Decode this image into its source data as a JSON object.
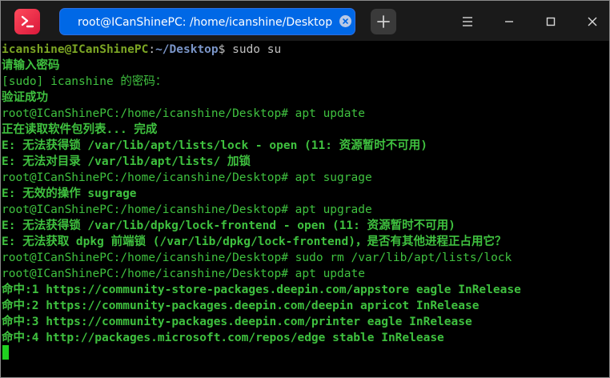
{
  "window": {
    "tab_title": "root@ICanShinePC: /home/icanshine/Desktop"
  },
  "terminal": {
    "first_prompt": {
      "user": "icanshine@ICanShinePC",
      "sep": ":",
      "path": "~/Desktop",
      "symbol": "$",
      "command": " sudo su"
    },
    "lines": [
      "请输入密码",
      "[sudo] icanshine 的密码：",
      "验证成功",
      "root@ICanShinePC:/home/icanshine/Desktop# apt update",
      "正在读取软件包列表... 完成",
      "E: 无法获得锁 /var/lib/apt/lists/lock - open (11: 资源暂时不可用)",
      "E: 无法对目录 /var/lib/apt/lists/ 加锁",
      "root@ICanShinePC:/home/icanshine/Desktop# apt sugrage",
      "E: 无效的操作 sugrage",
      "root@ICanShinePC:/home/icanshine/Desktop# apt upgrade",
      "E: 无法获得锁 /var/lib/dpkg/lock-frontend - open (11: 资源暂时不可用)",
      "E: 无法获取 dpkg 前端锁 (/var/lib/dpkg/lock-frontend)，是否有其他进程正占用它？",
      "root@ICanShinePC:/home/icanshine/Desktop# sudo rm /var/lib/apt/lists/lock",
      "root@ICanShinePC:/home/icanshine/Desktop# apt update",
      "命中:1 https://community-store-packages.deepin.com/appstore eagle InRelease",
      "命中:2 https://community-packages.deepin.com/deepin apricot InRelease",
      "命中:3 https://community-packages.deepin.com/printer eagle InRelease",
      "命中:4 http://packages.microsoft.com/repos/edge stable InRelease"
    ]
  },
  "colors": {
    "output_green": "#3fc13f",
    "tab_blue": "#0068e6",
    "cursor_green": "#20d020"
  }
}
